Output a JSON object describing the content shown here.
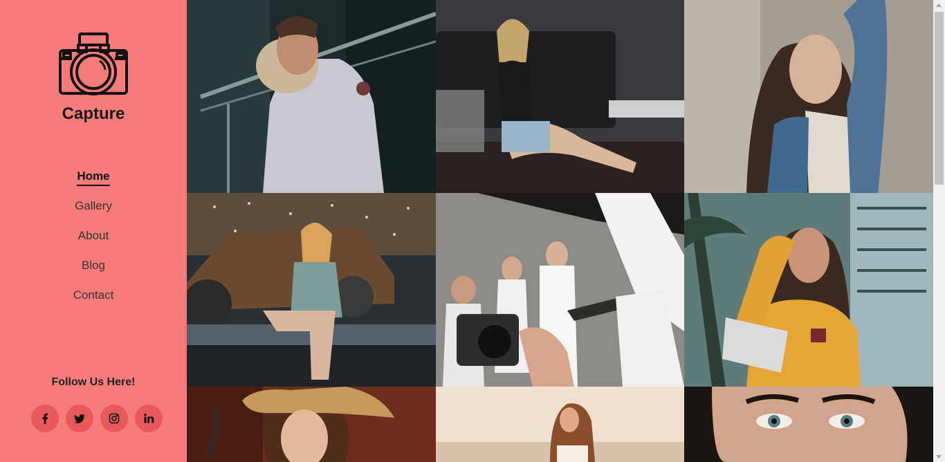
{
  "brand": {
    "name": "Capture",
    "logo_icon": "camera-icon"
  },
  "nav": {
    "items": [
      {
        "label": "Home",
        "active": true
      },
      {
        "label": "Gallery",
        "active": false
      },
      {
        "label": "About",
        "active": false
      },
      {
        "label": "Blog",
        "active": false
      },
      {
        "label": "Contact",
        "active": false
      }
    ]
  },
  "follow": {
    "title": "Follow Us Here!",
    "icons": [
      "facebook-icon",
      "twitter-icon",
      "instagram-icon",
      "linkedin-icon"
    ]
  },
  "gallery": {
    "photos": [
      "man in white parka by glass railing at night",
      "woman in black top sitting on floor by sofa",
      "woman in denim jacket with hand in hair",
      "woman sitting on flatbed truck with rusty car",
      "models behind the scenes with camera",
      "woman in yellow sweatshirt by palm trees",
      "woman with straw hat",
      "woman on beach at sunset",
      "close-up of woman's eyes"
    ]
  },
  "colors": {
    "sidebar_bg": "#f67c7a",
    "social_button_bg": "#e9595a",
    "text_dark": "#1a1a1a"
  }
}
